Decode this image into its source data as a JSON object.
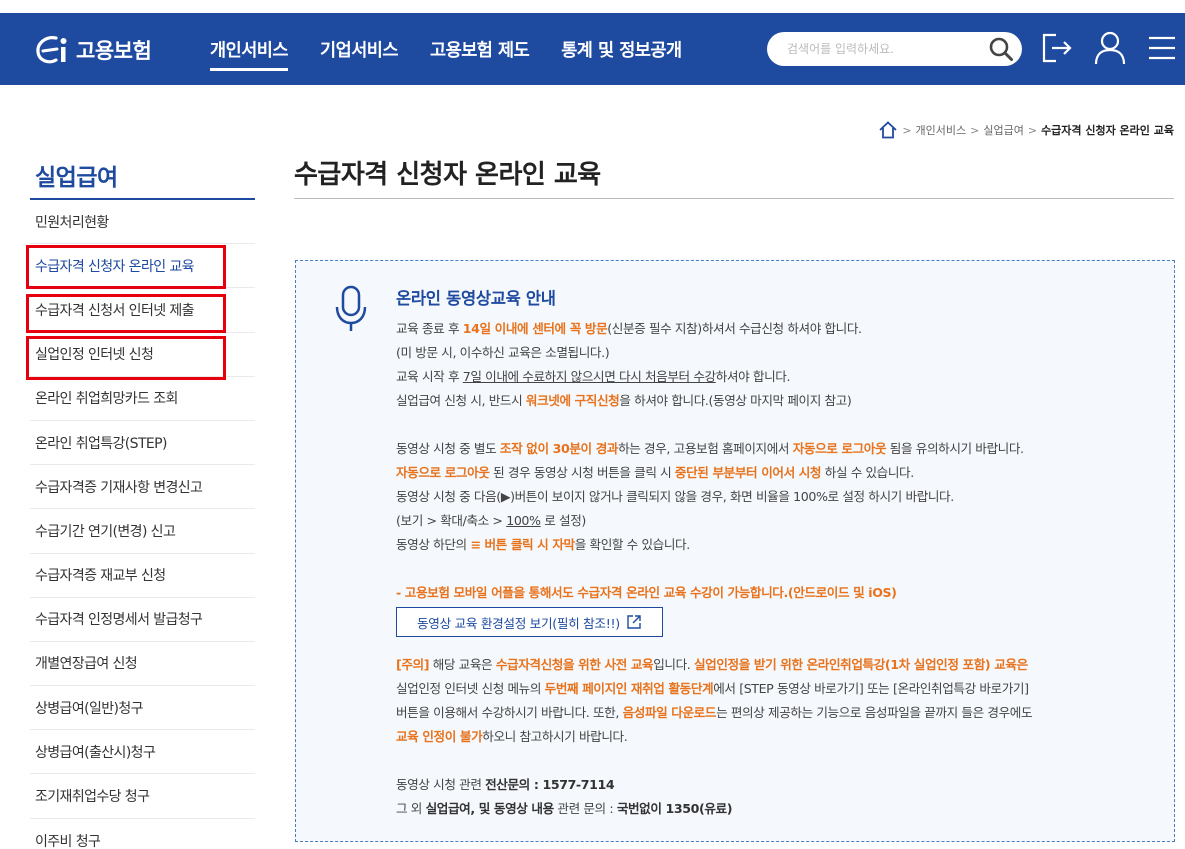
{
  "header": {
    "logo_text": "고용보험",
    "nav": [
      "개인서비스",
      "기업서비스",
      "고용보험 제도",
      "통계 및 정보공개"
    ],
    "search_placeholder": "검색어를 입력하세요."
  },
  "breadcrumb": [
    "개인서비스",
    "실업급여",
    "수급자격 신청자 온라인 교육"
  ],
  "sidebar": {
    "title": "실업급여",
    "items": [
      "민원처리현황",
      "수급자격 신청자 온라인 교육",
      "수급자격 신청서 인터넷 제출",
      "실업인정 인터넷 신청",
      "온라인 취업희망카드 조회",
      "온라인 취업특강(STEP)",
      "수급자격증 기재사항 변경신고",
      "수급기간 연기(변경) 신고",
      "수급자격증 재교부 신청",
      "수급자격 인정명세서 발급청구",
      "개별연장급여 신청",
      "상병급여(일반)청구",
      "상병급여(출산시)청구",
      "조기재취업수당 청구",
      "이주비 청구"
    ]
  },
  "main": {
    "title": "수급자격 신청자 온라인 교육",
    "box_title": "온라인 동영상교육 안내",
    "p1": {
      "a1": "교육 종료 후 ",
      "a2": "14일 이내에 센터에 꼭 방문",
      "a3": "(신분증 필수 지참)하셔서 수급신청 하셔야 합니다.",
      "b": "(미 방문 시, 이수하신 교육은 소멸됩니다.)",
      "c1": "교육 시작 후 ",
      "c2": "7일 이내에 수료하지 않으시면 다시 처음부터 수강",
      "c3": "하셔야 합니다.",
      "d1": "실업급여 신청 시, 반드시 ",
      "d2": "워크넷에 구직신청",
      "d3": "을 하셔야 합니다.(동영상 마지막 페이지 참고)"
    },
    "p2": {
      "a1": "동영상 시청 중 별도 ",
      "a2": "조작 없이 30분이 경과",
      "a3": "하는 경우, 고용보험 홈페이지에서 ",
      "a4": "자동으로 로그아웃",
      "a5": " 됨을 유의하시기 바랍니다.",
      "b1": "자동으로 로그아웃",
      "b2": " 된 경우 동영상 시청 버튼을 클릭 시 ",
      "b3": "중단된 부분부터 이어서 시청",
      "b4": " 하실 수 있습니다.",
      "c": "동영상 시청 중 다음(▶)버튼이 보이지 않거나 클릭되지 않을 경우, 화면 비율을 100%로 설정 하시기 바랍니다.",
      "d1": "(보기 > 확대/축소 > ",
      "d2": "100%",
      "d3": " 로 설정)",
      "e1": "동영상 하단의 ",
      "e2": "≡ 버튼 클릭 시 자막",
      "e3": "을 확인할 수 있습니다."
    },
    "mobile_note": "- 고용보험 모바일 어플을 통해서도 수급자격 온라인 교육 수강이 가능합니다.(안드로이드 및 iOS)",
    "env_button": "동영상 교육 환경설정 보기(필히 참조!!)",
    "p3": {
      "a1": "[주의]",
      "a2": " 해당 교육은 ",
      "a3": "수급자격신청을 위한 사전 교육",
      "a4": "입니다. ",
      "a5": "실업인정을 받기 위한 온라인취업특강(1차 실업인정 포함) 교육은",
      "b1": "실업인정 인터넷 신청 메뉴의 ",
      "b2": "두번째 페이지인 재취업 활동단계",
      "b3": "에서 [STEP 동영상 바로가기] 또는 [온라인취업특강 바로가기]",
      "c1": "버튼을 이용해서 수강하시기 바랍니다. 또한, ",
      "c2": "음성파일 다운로드",
      "c3": "는 편의상 제공하는 기능으로 음성파일을 끝까지 들은 경우에도",
      "d1": "교육 인정이 불가",
      "d2": "하오니 참고하시기 바랍니다."
    },
    "p4": {
      "a1": "동영상 시청 관련 ",
      "a2": "전산문의 : 1577-7114",
      "b1": "그 외 ",
      "b2": "실업급여, 및 동영상 내용",
      "b3": " 관련 문의 : ",
      "b4": "국번없이 1350(유료)"
    }
  },
  "colors": {
    "brand": "#1e4aa0",
    "accent": "#e8731c",
    "highlight_box": "#e6000f"
  }
}
